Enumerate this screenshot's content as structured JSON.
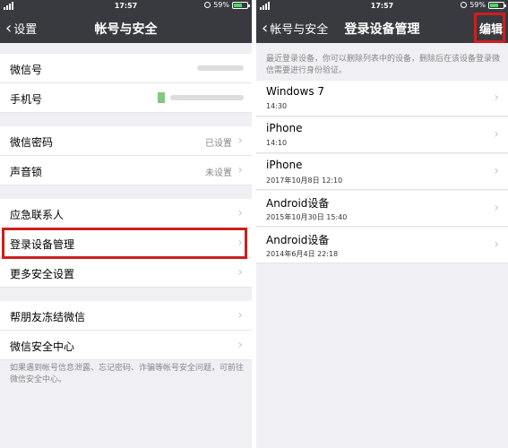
{
  "colors": {
    "navbar": "#393a3f",
    "highlight": "#cc1f1f",
    "background": "#efeff4"
  },
  "left": {
    "status": {
      "time": "17:57",
      "battery": "59%"
    },
    "nav": {
      "back_label": "设置",
      "title": "帐号与安全"
    },
    "rows": {
      "wechat_id": {
        "label": "微信号"
      },
      "phone": {
        "label": "手机号"
      },
      "password": {
        "label": "微信密码",
        "value": "已设置"
      },
      "voice_lock": {
        "label": "声音锁",
        "value": "未设置"
      },
      "emergency": {
        "label": "应急联系人"
      },
      "login_devices": {
        "label": "登录设备管理"
      },
      "more_security": {
        "label": "更多安全设置"
      },
      "help_freeze": {
        "label": "帮朋友冻结微信"
      },
      "security_center": {
        "label": "微信安全中心"
      }
    },
    "footer": "如果遇到帐号信息泄露、忘记密码、诈骗等帐号安全问题，可前往微信安全中心。"
  },
  "right": {
    "status": {
      "time": "17:57",
      "battery": "59%"
    },
    "nav": {
      "back_label": "帐号与安全",
      "title": "登录设备管理",
      "edit_label": "编辑"
    },
    "note": "最近登录设备，你可以删除列表中的设备，删除后在该设备登录微信需要进行身份验证。",
    "devices": [
      {
        "name": "Windows 7",
        "time": "14:30"
      },
      {
        "name": "iPhone",
        "time": "14:10"
      },
      {
        "name": "iPhone",
        "time": "2017年10月8日 12:10"
      },
      {
        "name": "Android设备",
        "time": "2015年10月30日 15:40"
      },
      {
        "name": "Android设备",
        "time": "2014年6月4日 22:18"
      }
    ]
  }
}
